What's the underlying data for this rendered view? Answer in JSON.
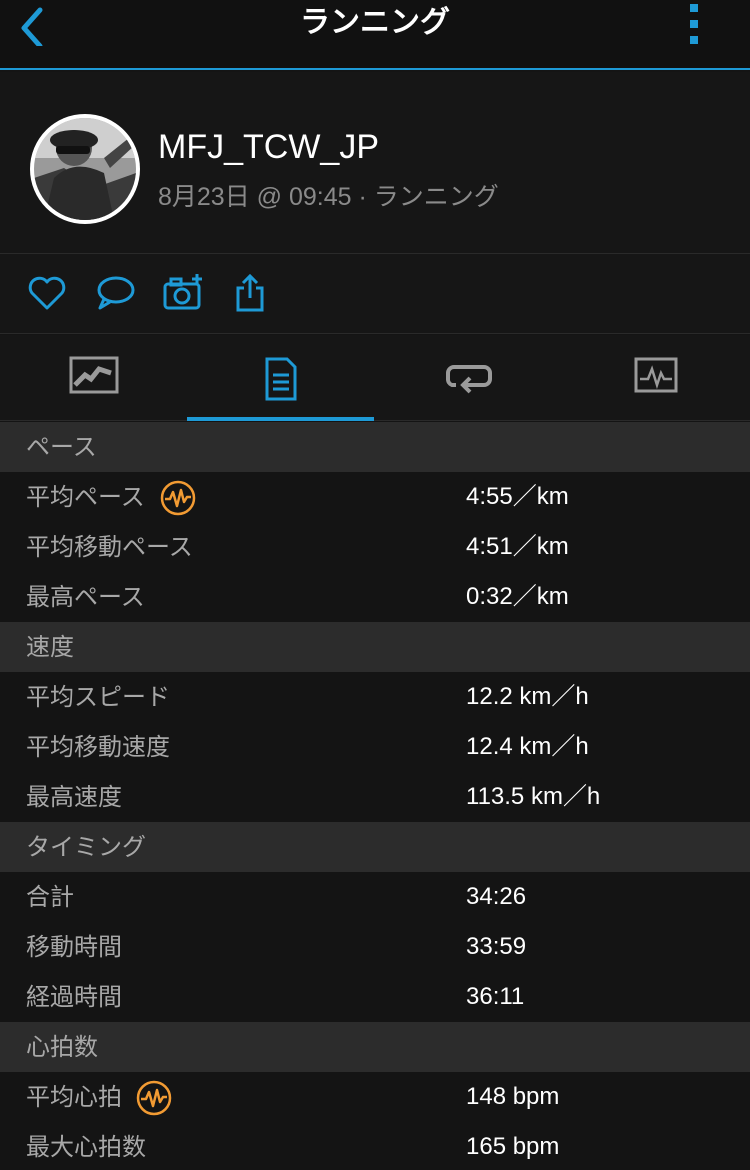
{
  "header": {
    "title": "ランニング"
  },
  "profile": {
    "username": "MFJ_TCW_JP",
    "subline": "8月23日 @ 09:45 · ランニング"
  },
  "actions": [
    "heart-icon",
    "comment-icon",
    "camera-add-icon",
    "share-icon"
  ],
  "tabs": [
    "map-tab",
    "stats-tab",
    "laps-tab",
    "charts-tab"
  ],
  "colors": {
    "accent": "#1e9ad6",
    "hr_icon": "#f29b33",
    "header_bg": "#2c2c2c"
  },
  "sections": {
    "pace": {
      "title": "ペース",
      "rows": [
        {
          "label": "平均ペース",
          "value": "4:55／km"
        },
        {
          "label": "平均移動ペース",
          "value": "4:51／km"
        },
        {
          "label": "最高ペース",
          "value": "0:32／km"
        }
      ]
    },
    "speed": {
      "title": "速度",
      "rows": [
        {
          "label": "平均スピード",
          "value": "12.2 km／h"
        },
        {
          "label": "平均移動速度",
          "value": "12.4 km／h"
        },
        {
          "label": "最高速度",
          "value": "113.5 km／h"
        }
      ]
    },
    "timing": {
      "title": "タイミング",
      "rows": [
        {
          "label": "合計",
          "value": "34:26"
        },
        {
          "label": "移動時間",
          "value": "33:59"
        },
        {
          "label": "経過時間",
          "value": "36:11"
        }
      ]
    },
    "heart": {
      "title": "心拍数",
      "rows": [
        {
          "label": "平均心拍",
          "value": "148 bpm"
        },
        {
          "label": "最大心拍数",
          "value": "165 bpm"
        }
      ]
    }
  }
}
